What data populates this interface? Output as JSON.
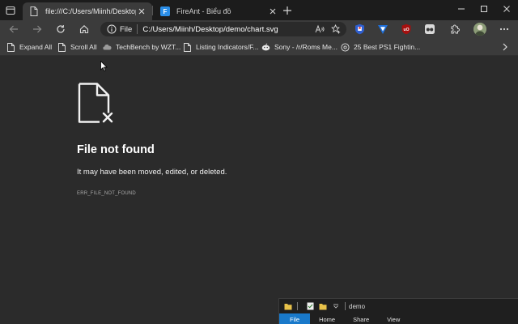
{
  "tabs": [
    {
      "title": "file:///C:/Users/Miinh/Desktop/d",
      "active": true
    },
    {
      "title": "FireAnt - Biểu đồ",
      "favicon_text": "F",
      "active": false
    }
  ],
  "address_bar": {
    "scheme_label": "File",
    "url": "C:/Users/Miinh/Desktop/demo/chart.svg"
  },
  "bookmarks": [
    {
      "label": "Expand All",
      "icon": "page-icon"
    },
    {
      "label": "Scroll All",
      "icon": "page-icon"
    },
    {
      "label": "TechBench by WZT...",
      "icon": "cloud-icon"
    },
    {
      "label": "Listing Indicators/F...",
      "icon": "page-icon"
    },
    {
      "label": "Sony - /r/Roms Me...",
      "icon": "reddit-icon"
    },
    {
      "label": "25 Best PS1 Fightin...",
      "icon": "globe-icon"
    }
  ],
  "error": {
    "title": "File not found",
    "description": "It may have been moved, edited, or deleted.",
    "code": "ERR_FILE_NOT_FOUND"
  },
  "explorer": {
    "path": "demo",
    "ribbon_tabs": [
      "File",
      "Home",
      "Share",
      "View"
    ]
  },
  "colors": {
    "page_background": "#2b2b2b",
    "toolbar": "#3b3b3b",
    "ribbon_file_tab": "#1979ca"
  }
}
